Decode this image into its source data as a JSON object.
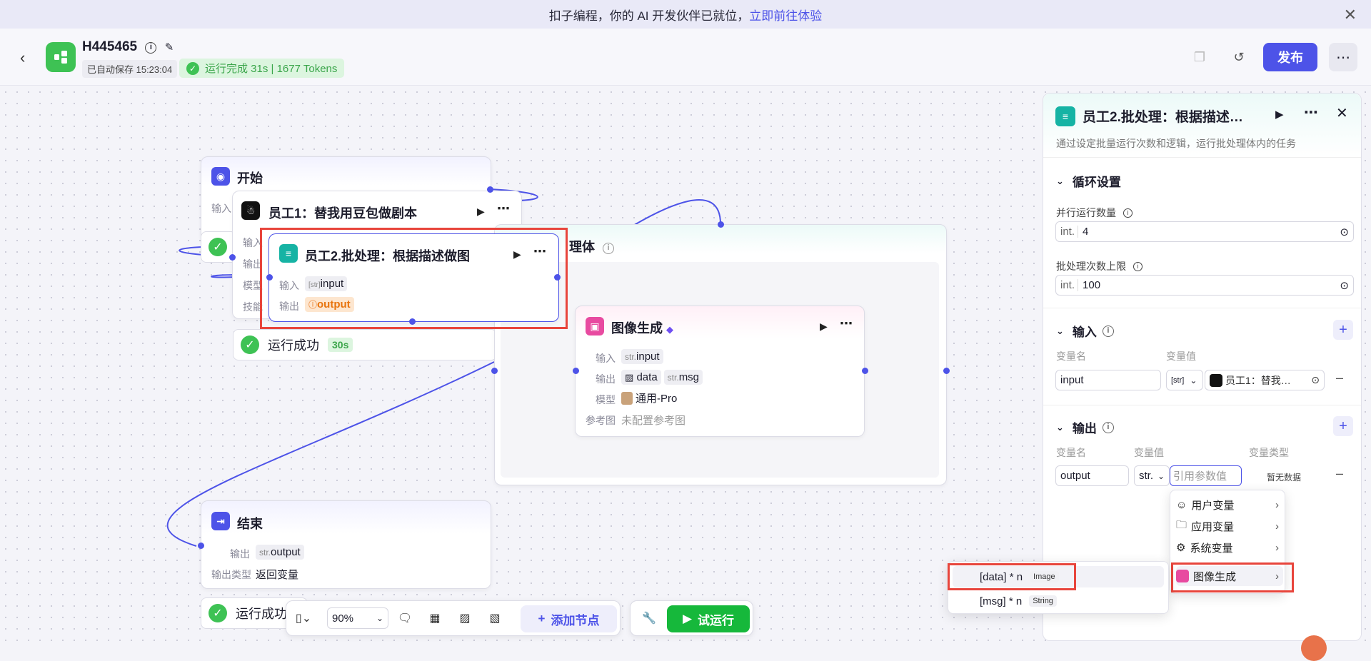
{
  "banner": {
    "text": "扣子编程，你的 AI 开发伙伴已就位，",
    "link": "立即前往体验",
    "close": "✕"
  },
  "header": {
    "app_name": "H445465",
    "autosave": "已自动保存 15:23:04",
    "run_status": "运行完成 31s | 1677 Tokens",
    "publish_label": "发布"
  },
  "nodes": {
    "start": {
      "title": "开始",
      "input_label": "输入"
    },
    "emp1": {
      "title": "员工1：替我用豆包做剧本",
      "row_labels": [
        "输入",
        "输出",
        "模型",
        "技能"
      ],
      "status": "运行成功",
      "time": "30s"
    },
    "emp2": {
      "title": "员工2.批处理：根据描述做图",
      "input_label": "输入",
      "input_var": "input",
      "input_type": "[str]",
      "output_label": "输出",
      "output_var": "output"
    },
    "batch_body": {
      "title": "理体"
    },
    "imagegen": {
      "title": "图像生成",
      "input_label": "输入",
      "input_type": "str.",
      "input_var": "input",
      "output_label": "输出",
      "out1": "data",
      "out2_type": "str.",
      "out2": "msg",
      "model_label": "模型",
      "model": "通用-Pro",
      "ref_label": "参考图",
      "ref": "未配置参考图"
    },
    "end": {
      "title": "结束",
      "output_label": "输出",
      "output_type": "str.",
      "output_var": "output",
      "otype_label": "输出类型",
      "otype": "返回变量",
      "status": "运行成功"
    }
  },
  "toolbar": {
    "zoom": "90%",
    "add_node": "添加节点",
    "test_run": "试运行"
  },
  "panel": {
    "title": "员工2.批处理：根据描述…",
    "desc": "通过设定批量运行次数和逻辑，运行批处理体内的任务",
    "loop_section": "循环设置",
    "parallel_label": "并行运行数量",
    "parallel_type": "int.",
    "parallel_value": "4",
    "limit_label": "批处理次数上限",
    "limit_type": "int.",
    "limit_value": "100",
    "input_section": "输入",
    "col_varname": "变量名",
    "col_varvalue": "变量值",
    "input_name": "input",
    "input_type": "[str]",
    "input_ref": "员工1：替我…",
    "output_section": "输出",
    "col_vartype": "变量类型",
    "output_name": "output",
    "output_type": "str.",
    "output_placeholder": "引用参数值",
    "output_nodata": "暂无数据"
  },
  "menu": {
    "items": [
      "用户变量",
      "应用变量",
      "系统变量",
      "图像生成"
    ],
    "sub": [
      {
        "name": "[data] * n",
        "type": "Image"
      },
      {
        "name": "[msg] * n",
        "type": "String"
      }
    ]
  },
  "colors": {
    "accent": "#4d53e8",
    "success": "#3ec254",
    "highlight": "#e8453c"
  }
}
